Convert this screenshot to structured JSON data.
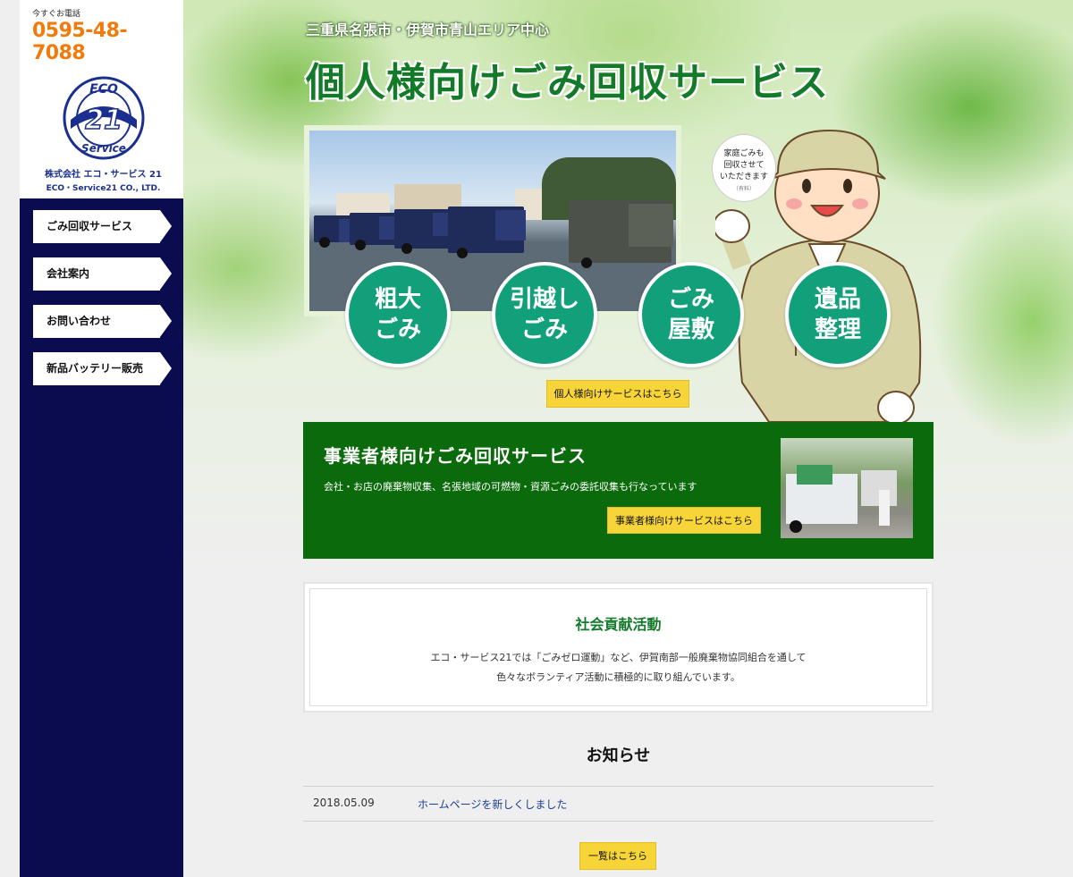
{
  "contact": {
    "tel_label": "今すぐお電話",
    "tel_number": "0595-48-7088"
  },
  "company": {
    "name_jp": "株式会社 エコ・サービス 21",
    "name_en": "ECO・Service21 CO., LTD."
  },
  "nav": {
    "items": [
      {
        "label": "ごみ回収サービス"
      },
      {
        "label": "会社案内"
      },
      {
        "label": "お問い合わせ"
      },
      {
        "label": "新品バッテリー販売"
      }
    ]
  },
  "hero": {
    "subtitle": "三重県名張市・伊賀市青山エリア中心",
    "title": "個人様向けごみ回収サービス",
    "services": [
      {
        "label": "粗大\nごみ"
      },
      {
        "label": "引越し\nごみ"
      },
      {
        "label": "ごみ\n屋敷"
      },
      {
        "label": "遺品\n整理"
      }
    ],
    "button": "個人様向けサービスはこちら",
    "speech": {
      "line1": "家庭ごみも",
      "line2": "回収させて",
      "line3": "いただきます",
      "note": "（有料）"
    }
  },
  "business": {
    "title": "事業者様向けごみ回収サービス",
    "description": "会社・お店の廃棄物収集、名張地域の可燃物・資源ごみの委託収集も行なっています",
    "button": "事業者様向けサービスはこちら"
  },
  "csr": {
    "title": "社会貢献活動",
    "line1": "エコ・サービス21では「ごみゼロ運動」など、伊賀南部一般廃棄物協同組合を通して",
    "line2": "色々なボランティア活動に積極的に取り組んでいます。"
  },
  "news": {
    "title": "お知らせ",
    "items": [
      {
        "date": "2018.05.09",
        "text": "ホームページを新しくしました"
      }
    ],
    "more_button": "一覧はこちら"
  },
  "colors": {
    "sidebar": "#0b0b4f",
    "accent_green": "#137a2a",
    "circle_teal": "#12a07a",
    "button_yellow": "#f7d437",
    "phone_orange": "#f07a0a"
  }
}
